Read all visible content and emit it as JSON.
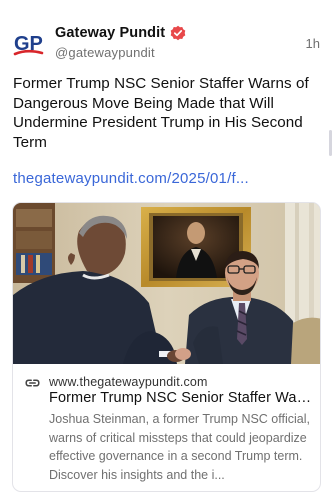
{
  "post": {
    "author_name": "Gateway Pundit",
    "handle": "@gatewaypundit",
    "time": "1h",
    "avatar_initials": "GP",
    "text": "Former Trump NSC Senior Staffer Warns of Dangerous Move Being Made that Will Undermine President Trump in His Second Term",
    "link": "thegatewaypundit.com/2025/01/f..."
  },
  "link_card": {
    "domain": "www.thegatewaypundit.com",
    "title": "Former Trump NSC Senior Staffer War...",
    "description": "Joshua Steinman, a former Trump NSC official, warns of critical missteps that could jeopardize effective governance in a second Trump term. Discover his insights and the i..."
  },
  "colors": {
    "avatar_blue": "#1f3f8c",
    "avatar_red": "#d8262b",
    "verified_badge": "#e8484a",
    "link": "#3a67d8"
  }
}
